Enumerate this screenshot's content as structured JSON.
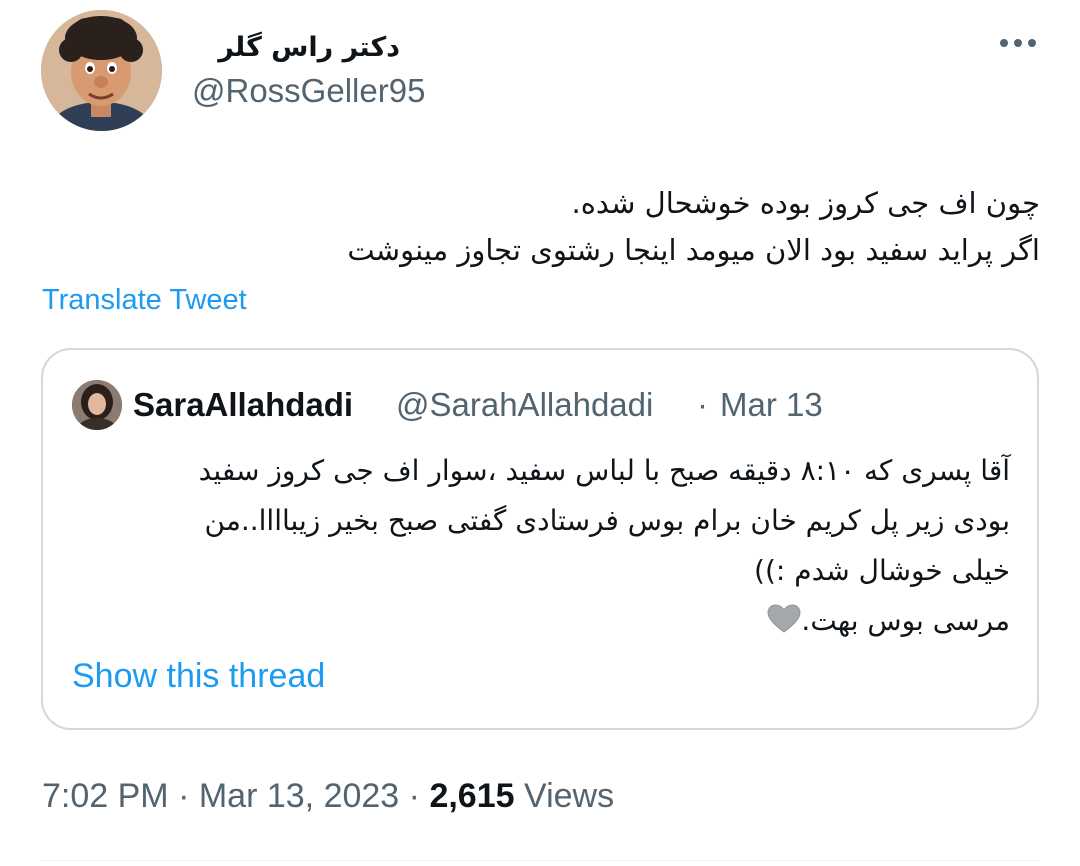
{
  "author": {
    "display_name": "دکتر راس گلر",
    "handle": "@RossGeller95"
  },
  "more_icon": "more-horizontal-icon",
  "tweet": {
    "lines": [
      "چون اف جی کروز بوده خوشحال شده.",
      "اگر پراید سفید بود الان میومد اینجا رشتوی تجاوز مینوشت"
    ],
    "translate_label": "Translate Tweet"
  },
  "quoted": {
    "name": "SaraAllahdadi",
    "handle": "@SarahAllahdadi",
    "separator": "·",
    "date": "Mar 13",
    "lines": [
      "آقا پسری که ۸:۱۰ دقیقه صبح با لباس سفید ،سوار اف جی کروز سفید",
      "بودی زیر پل کریم خان برام بوس فرستادی گفتی صبح بخیر زیباااا..من",
      "خیلی خوشال شدم :))",
      "مرسی بوس بهت."
    ],
    "emoji": "grey-heart-icon",
    "show_thread_label": "Show this thread"
  },
  "meta": {
    "time": "7:02 PM",
    "separator": "·",
    "date": "Mar 13, 2023",
    "views_count": "2,615",
    "views_label": "Views"
  },
  "colors": {
    "link": "#1d9bf0",
    "secondary_text": "#536471",
    "border": "#cfd9de"
  }
}
